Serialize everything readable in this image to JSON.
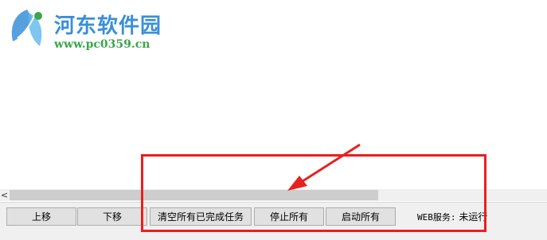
{
  "watermark": {
    "site_name": "河东软件园",
    "url": "www.pc0359.cn"
  },
  "scrollbar": {
    "left_arrow": "<"
  },
  "toolbar": {
    "move_up_label": "上移",
    "move_down_label": "下移",
    "clear_completed_label": "清空所有已完成任务",
    "stop_all_label": "停止所有",
    "start_all_label": "启动所有"
  },
  "status": {
    "web_service_label": "WEB服务:",
    "web_service_value": "未运行"
  },
  "colors": {
    "annotation": "#e8201f",
    "watermark_title": "#3a8fd8",
    "watermark_url": "#3aa64a"
  },
  "icons": {
    "watermark_logo": "leaf-logo-icon",
    "annotation_arrow": "red-arrow-icon"
  }
}
